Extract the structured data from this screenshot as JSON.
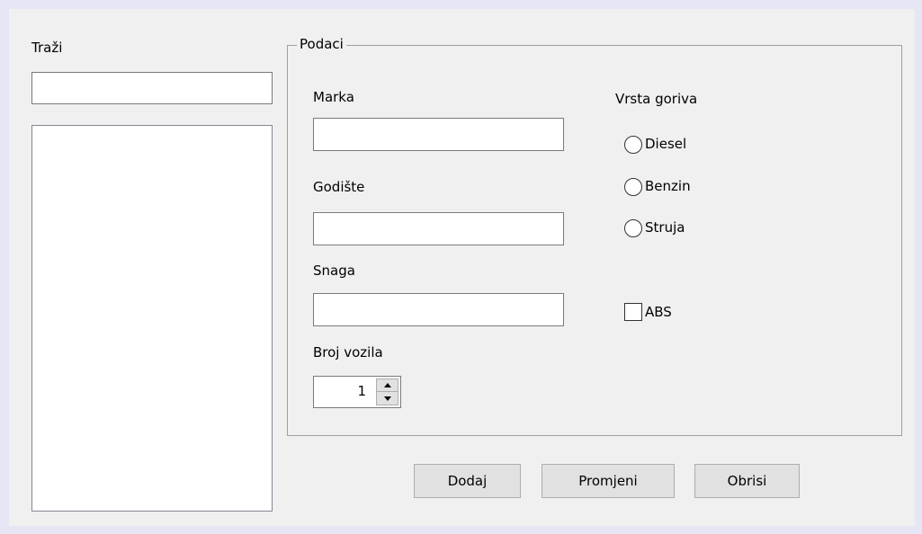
{
  "search": {
    "label": "Traži",
    "value": ""
  },
  "group": {
    "title": "Podaci"
  },
  "fields": {
    "marka": {
      "label": "Marka",
      "value": ""
    },
    "godiste": {
      "label": "Godište",
      "value": ""
    },
    "snaga": {
      "label": "Snaga",
      "value": ""
    },
    "broj_vozila": {
      "label": "Broj vozila",
      "value": "1"
    }
  },
  "fuel": {
    "label": "Vrsta goriva",
    "options": [
      "Diesel",
      "Benzin",
      "Struja"
    ],
    "selected": null
  },
  "abs": {
    "label": "ABS",
    "checked": false
  },
  "buttons": {
    "add": "Dodaj",
    "change": "Promjeni",
    "delete": "Obrisi"
  }
}
